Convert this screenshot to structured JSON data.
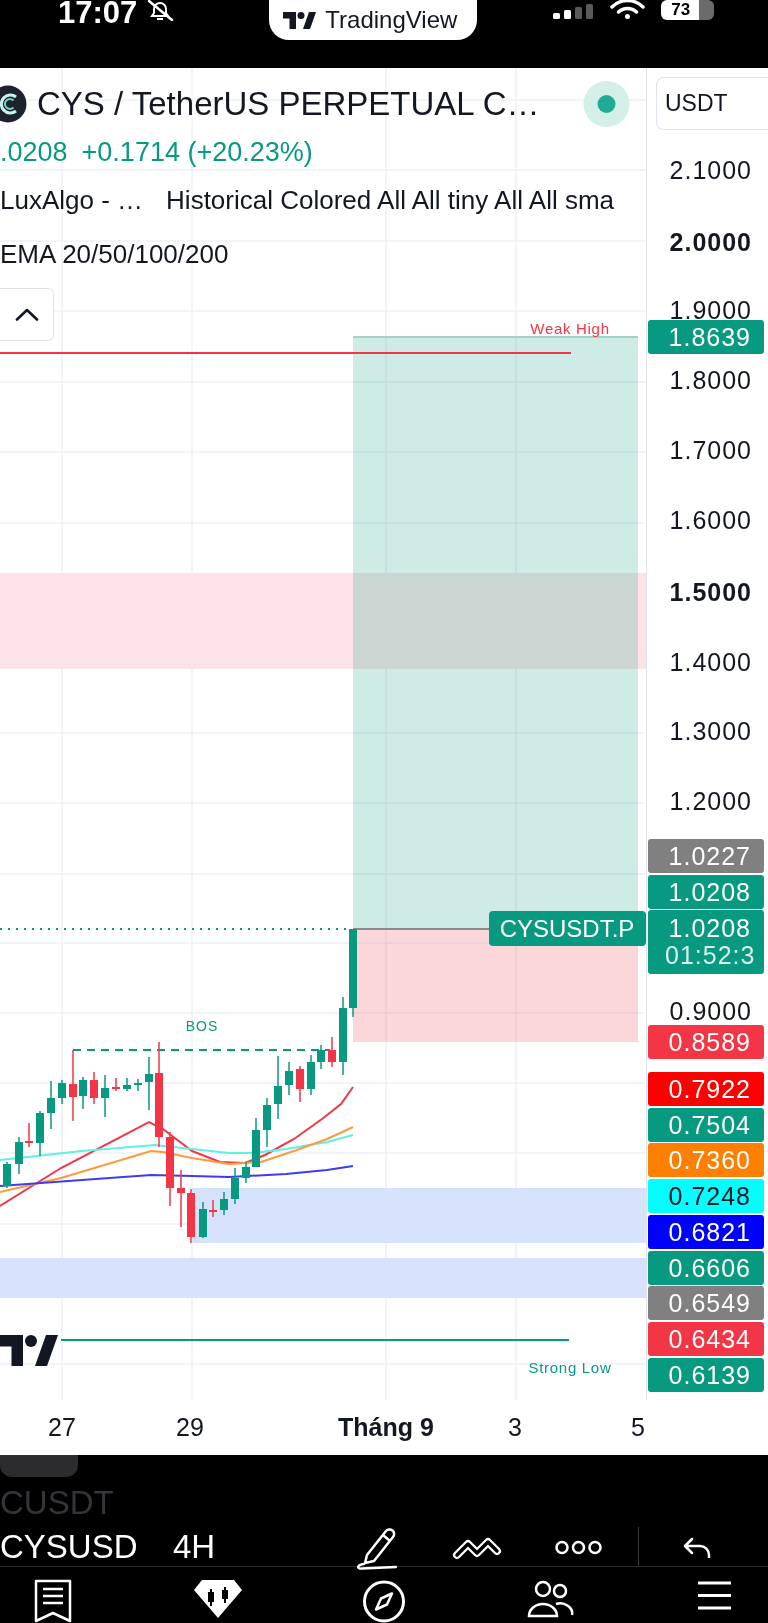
{
  "status_bar": {
    "time": "17:07",
    "app_pill": "TradingView",
    "battery": "73"
  },
  "header": {
    "title": "CYS / TetherUS PERPETUAL C…",
    "market_open": true,
    "currency": "USDT",
    "last_price": ".0208",
    "change": "+0.1714 (+20.23%)",
    "indicator_rows": [
      [
        "LuxAlgo - …",
        "Historical Colored All All tiny All All sma"
      ],
      [
        "EMA 20/50/100/200"
      ]
    ],
    "legend_expanded": true
  },
  "chart": {
    "weak_high": "Weak High",
    "symbol_tag": "CYSUSDT.P",
    "bos": "BOS",
    "strong_low": "Strong Low"
  },
  "price_axis": {
    "items": [
      {
        "kind": "tick",
        "label": "2.1000"
      },
      {
        "kind": "major_tick",
        "label": "2.0000"
      },
      {
        "kind": "tick",
        "label": "1.9000"
      },
      {
        "kind": "badge",
        "label": "1.8639",
        "color": "#089981"
      },
      {
        "kind": "tick",
        "label": "1.8000"
      },
      {
        "kind": "tick",
        "label": "1.7000"
      },
      {
        "kind": "tick",
        "label": "1.6000"
      },
      {
        "kind": "major_tick",
        "label": "1.5000"
      },
      {
        "kind": "tick",
        "label": "1.4000"
      },
      {
        "kind": "tick",
        "label": "1.3000"
      },
      {
        "kind": "tick",
        "label": "1.2000"
      },
      {
        "kind": "badge",
        "label": "1.0227",
        "color": "#808080"
      },
      {
        "kind": "badge",
        "label": "1.0208",
        "color": "#089981"
      },
      {
        "kind": "badge",
        "label": "1.0208",
        "sub": "01:52:3",
        "color": "#089981"
      },
      {
        "kind": "tick",
        "label": "0.9000"
      },
      {
        "kind": "badge",
        "label": "0.8589",
        "color": "#f23645"
      },
      {
        "kind": "badge",
        "label": "0.7922",
        "color": "#ff0000"
      },
      {
        "kind": "badge",
        "label": "0.7504",
        "color": "#089981"
      },
      {
        "kind": "badge",
        "label": "0.7360",
        "color": "#ff7f00"
      },
      {
        "kind": "badge",
        "label": "0.7248",
        "color": "#00ffff"
      },
      {
        "kind": "badge",
        "label": "0.6821",
        "color": "#0000ff"
      },
      {
        "kind": "badge",
        "label": "0.6606",
        "color": "#089981"
      },
      {
        "kind": "badge",
        "label": "0.6549",
        "color": "#808080"
      },
      {
        "kind": "badge",
        "label": "0.6434",
        "color": "#f23645"
      },
      {
        "kind": "badge",
        "label": "0.6139",
        "color": "#089981"
      }
    ]
  },
  "time_axis": {
    "labels": [
      {
        "label": "27",
        "kind": "day"
      },
      {
        "label": "29",
        "kind": "day"
      },
      {
        "label": "Tháng 9",
        "kind": "month"
      },
      {
        "label": "3",
        "kind": "day"
      },
      {
        "label": "5",
        "kind": "day"
      }
    ]
  },
  "bottom_bar": {
    "previous_symbol": "CUSDT",
    "symbol": "CYSUSD",
    "interval": "4H"
  }
}
